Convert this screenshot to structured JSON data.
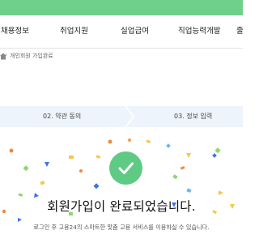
{
  "colors": {
    "brand_green": "#6ed08a",
    "check_green": "#5fca84",
    "steps_bg": "#eef4fb"
  },
  "gnb": {
    "items": [
      {
        "label": "채용정보"
      },
      {
        "label": "취업지원"
      },
      {
        "label": "실업급여"
      },
      {
        "label": "직업능력개발"
      },
      {
        "label": "줄"
      }
    ]
  },
  "breadcrumb": {
    "icon": "home-icon",
    "current": "개인회원 가입완료"
  },
  "steps": [
    {
      "label": "02. 약관 동의"
    },
    {
      "label": "03. 정보 입력"
    }
  ],
  "complete": {
    "icon": "check-icon",
    "title": "회원가입이 완료되었습니다.",
    "description": "로그인 후 고용24의 스마트한 맞춤 고용 서비스를 이용하실 수 있습니다."
  }
}
